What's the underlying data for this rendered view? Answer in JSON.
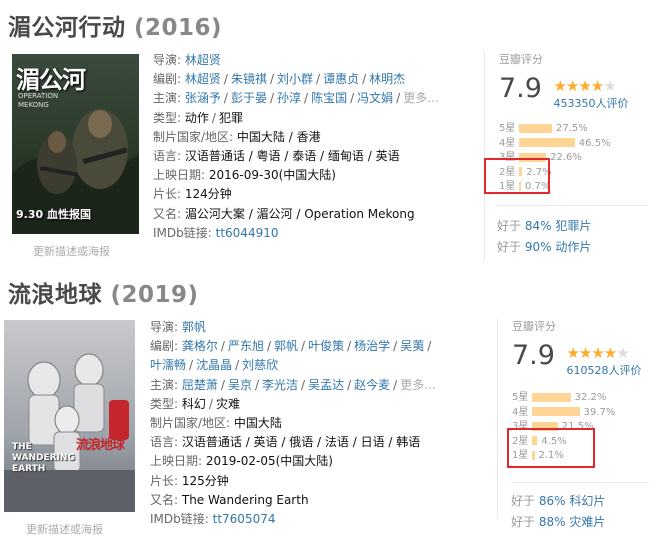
{
  "movies": [
    {
      "title": "湄公河行动",
      "year": "(2016)",
      "poster": {
        "title_art": "湄公河",
        "subtitle": "OPERATION MEKONG",
        "date_text": "9.30 血性报国"
      },
      "poster_link": "更新描述或海报",
      "director_label": "导演:",
      "directors": [
        "林超贤"
      ],
      "writer_label": "编剧:",
      "writers": [
        "林超贤",
        "朱镜祺",
        "刘小群",
        "谭惠贞",
        "林明杰"
      ],
      "cast_label": "主演:",
      "cast": [
        "张涵予",
        "彭于晏",
        "孙淳",
        "陈宝国",
        "冯文娟"
      ],
      "more": "更多...",
      "genre_label": "类型:",
      "genres": [
        "动作",
        "犯罪"
      ],
      "region_label": "制片国家/地区:",
      "region": "中国大陆 / 香港",
      "language_label": "语言:",
      "language": "汉语普通话 / 粤语 / 泰语 / 缅甸语 / 英语",
      "release_label": "上映日期:",
      "release": "2016-09-30(中国大陆)",
      "runtime_label": "片长:",
      "runtime": "124分钟",
      "aka_label": "又名:",
      "aka": "湄公河大案 / 湄公河 / Operation Mekong",
      "imdb_label": "IMDb链接:",
      "imdb": "tt6044910",
      "rating": {
        "label": "豆瓣评分",
        "score": "7.9",
        "stars": 4,
        "votes": "453350人评价",
        "histogram": [
          {
            "label": "5星",
            "pct_text": "27.5%",
            "pct": 27.5
          },
          {
            "label": "4星",
            "pct_text": "46.5%",
            "pct": 46.5
          },
          {
            "label": "3星",
            "pct_text": "22.6%",
            "pct": 22.6
          },
          {
            "label": "2星",
            "pct_text": "2.7%",
            "pct": 2.7
          },
          {
            "label": "1星",
            "pct_text": "0.7%",
            "pct": 0.7
          }
        ],
        "better_than": [
          {
            "prefix": "好于",
            "pct": "84%",
            "category": "犯罪片"
          },
          {
            "prefix": "好于",
            "pct": "90%",
            "category": "动作片"
          }
        ]
      }
    },
    {
      "title": "流浪地球",
      "year": "(2019)",
      "poster": {
        "title_art": "流浪地球",
        "subtitle": "THE WANDERING EARTH"
      },
      "poster_link": "更新描述或海报",
      "director_label": "导演:",
      "directors": [
        "郭帆"
      ],
      "writer_label": "编剧:",
      "writers": [
        "龚格尔",
        "严东旭",
        "郭帆",
        "叶俊策",
        "杨治学",
        "吴荑",
        "叶濡畅",
        "沈晶晶",
        "刘慈欣"
      ],
      "cast_label": "主演:",
      "cast": [
        "屈楚萧",
        "吴京",
        "李光洁",
        "吴孟达",
        "赵今麦"
      ],
      "more": "更多...",
      "genre_label": "类型:",
      "genres": [
        "科幻",
        "灾难"
      ],
      "region_label": "制片国家/地区:",
      "region": "中国大陆",
      "language_label": "语言:",
      "language": "汉语普通话 / 英语 / 俄语 / 法语 / 日语 / 韩语",
      "release_label": "上映日期:",
      "release": "2019-02-05(中国大陆)",
      "runtime_label": "片长:",
      "runtime": "125分钟",
      "aka_label": "又名:",
      "aka": "The Wandering Earth",
      "imdb_label": "IMDb链接:",
      "imdb": "tt7605074",
      "rating": {
        "label": "豆瓣评分",
        "score": "7.9",
        "stars": 4,
        "votes": "610528人评价",
        "histogram": [
          {
            "label": "5星",
            "pct_text": "32.2%",
            "pct": 32.2
          },
          {
            "label": "4星",
            "pct_text": "39.7%",
            "pct": 39.7
          },
          {
            "label": "3星",
            "pct_text": "21.5%",
            "pct": 21.5
          },
          {
            "label": "2星",
            "pct_text": "4.5%",
            "pct": 4.5
          },
          {
            "label": "1星",
            "pct_text": "2.1%",
            "pct": 2.1
          }
        ],
        "better_than": [
          {
            "prefix": "好于",
            "pct": "86%",
            "category": "科幻片"
          },
          {
            "prefix": "好于",
            "pct": "88%",
            "category": "灾难片"
          }
        ]
      }
    }
  ],
  "colors": {
    "link": "#3377aa",
    "star": "#ffac2d",
    "bar": "#ffd596",
    "highlight": "#e0282d"
  }
}
